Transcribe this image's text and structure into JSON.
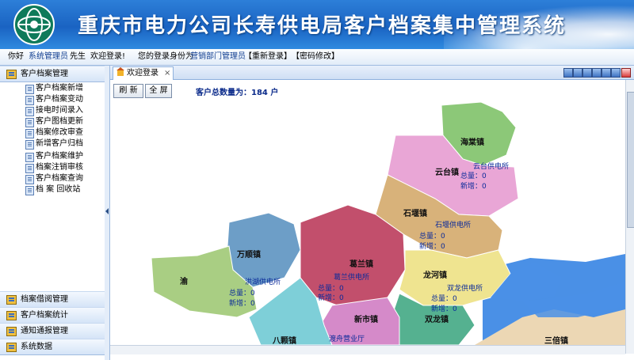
{
  "header": {
    "title": "重庆市电力公司长寿供电局客户档案集中管理系统"
  },
  "userbar": {
    "greeting": "你好",
    "user": "系统管理员",
    "honorific": "先生",
    "welcome": "欢迎登录!",
    "role_label": "您的登录身份为",
    "role": "营销部门管理员",
    "relogin": "【重新登录】",
    "change_pwd": "【密码修改】"
  },
  "sidebar": {
    "top_section": "客户档案管理",
    "items": [
      {
        "label": "客户档案新增"
      },
      {
        "label": "客户档案变动"
      },
      {
        "label": "接电时间录入"
      },
      {
        "label": "客户图档更新"
      },
      {
        "label": "档案修改审查"
      },
      {
        "label": "新增客户归档"
      },
      {
        "label": "客户档案维护"
      },
      {
        "label": "档案注销审核"
      },
      {
        "label": "客户档案查询"
      },
      {
        "label": "档 案 回收站"
      }
    ],
    "bottom_sections": [
      {
        "label": "档案借阅管理"
      },
      {
        "label": "客户档案统计"
      },
      {
        "label": "通知通报管理"
      },
      {
        "label": "系统数据"
      }
    ]
  },
  "tabs": [
    {
      "label": "欢迎登录",
      "close": "×"
    }
  ],
  "toolbar": {
    "refresh": "刷 新",
    "fullscreen": "全 屏"
  },
  "summary": "客户总数量为：184 户",
  "map": {
    "colors": {
      "water": "#4a90e6"
    },
    "towns": [
      {
        "name": "海棠镇"
      },
      {
        "name": "云台镇",
        "station": "云台供电所",
        "total": "总量：0",
        "new": "新增：0"
      },
      {
        "name": "石堰镇",
        "station": "石堰供电所",
        "total": "总量：0",
        "new": "新增：0"
      },
      {
        "name": "万顺镇"
      },
      {
        "name": "葛兰镇",
        "station": "葛兰供电所",
        "total": "总量：0",
        "new": "新增：0"
      },
      {
        "name": "龙河镇",
        "station": "双龙供电所",
        "total": "总量：0",
        "new": "新增：0"
      },
      {
        "name": "双龙镇"
      },
      {
        "name": "新市镇"
      },
      {
        "name": "三倍镇"
      },
      {
        "name": "八颗镇"
      }
    ],
    "extra_labels": {
      "lake_station": "洪湖供电所",
      "lake_total": "总量：0",
      "lake_new": "新增：0",
      "sales_hall": "渡舟营业厅",
      "partial_town": "渝"
    }
  }
}
